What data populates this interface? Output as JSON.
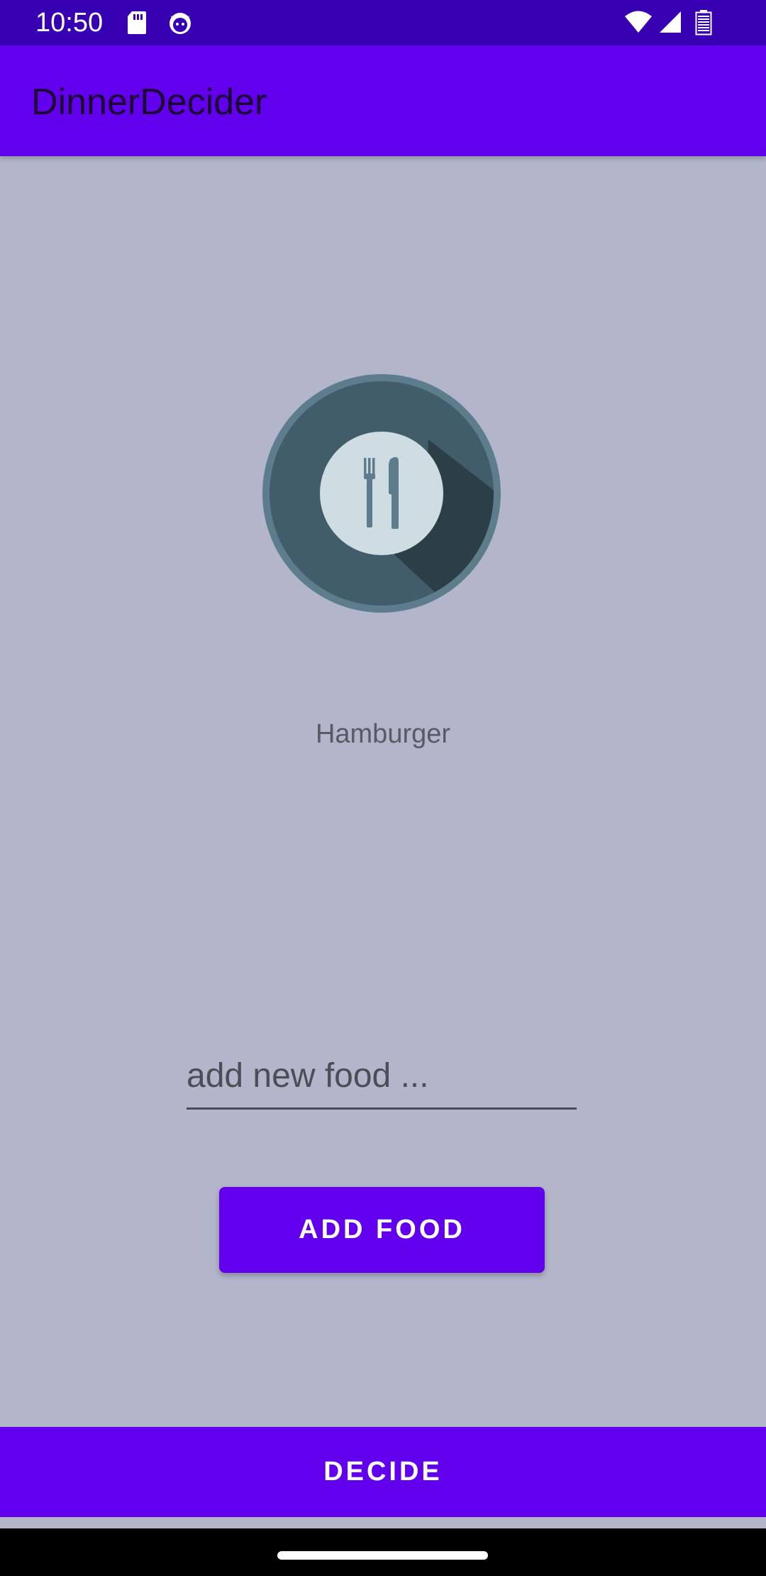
{
  "status_bar": {
    "time": "10:50",
    "icons": [
      "sd-card-icon",
      "cat-face-icon",
      "wifi-icon",
      "cell-signal-icon",
      "battery-icon"
    ]
  },
  "app_bar": {
    "title": "DinnerDecider"
  },
  "main": {
    "selected_food": "Hamburger",
    "image_icon": "plate-fork-knife-icon",
    "input": {
      "value": "",
      "placeholder": "add new food ..."
    },
    "add_food_label": "ADD FOOD"
  },
  "bottom": {
    "decide_label": "DECIDE"
  },
  "colors": {
    "primary": "#6200ee",
    "primary_dark": "#3700b3",
    "background": "#b3b6ca"
  }
}
